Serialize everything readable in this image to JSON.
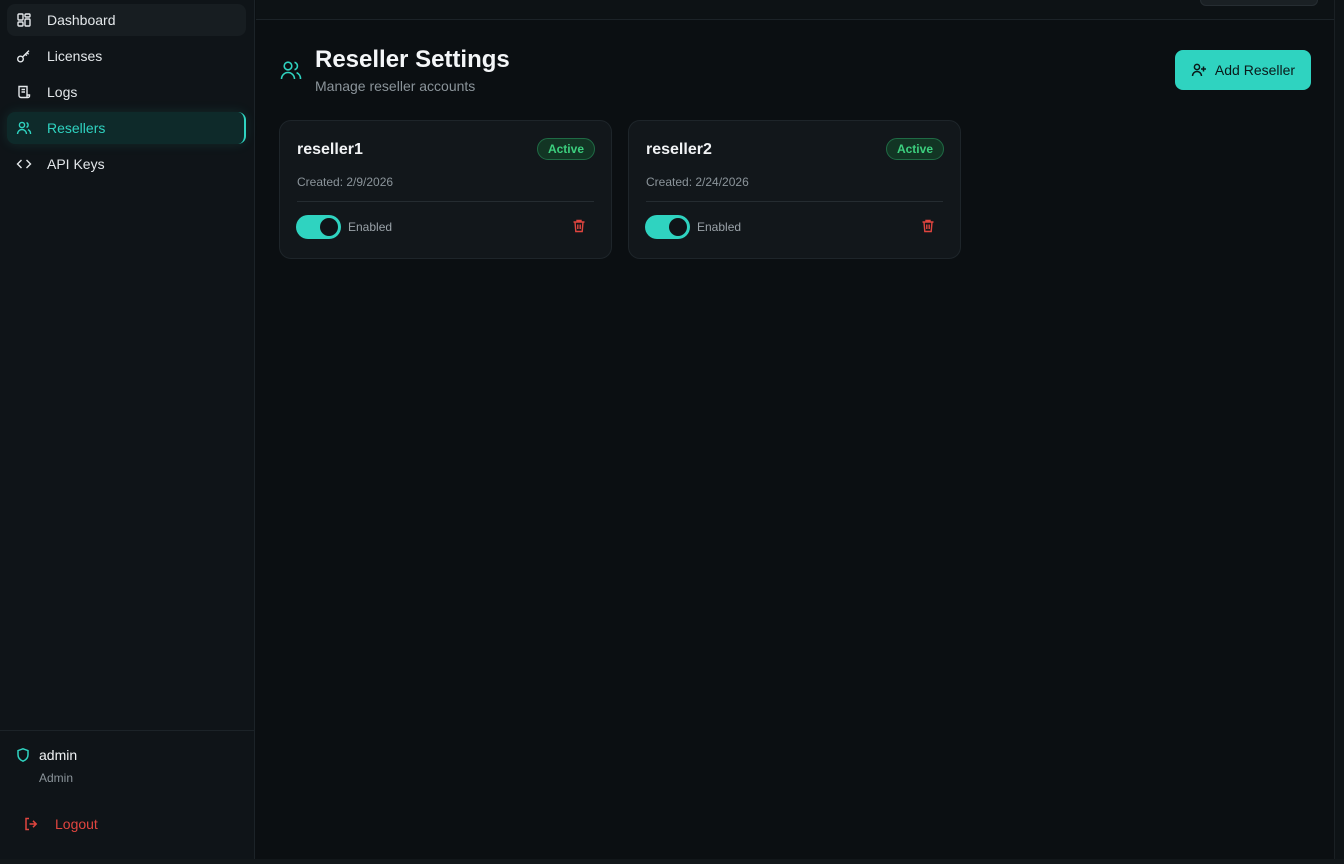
{
  "sidebar": {
    "items": [
      {
        "label": "Dashboard",
        "icon": "dashboard-grid-icon"
      },
      {
        "label": "Licenses",
        "icon": "key-icon"
      },
      {
        "label": "Logs",
        "icon": "scroll-icon"
      },
      {
        "label": "Resellers",
        "icon": "users-icon"
      },
      {
        "label": "API Keys",
        "icon": "code-icon"
      }
    ],
    "active": "Resellers",
    "user": {
      "name": "admin",
      "role": "Admin"
    },
    "logout_label": "Logout"
  },
  "header": {
    "title": "Reseller Settings",
    "subtitle": "Manage reseller accounts",
    "add_button_label": "Add Reseller"
  },
  "resellers": [
    {
      "name": "reseller1",
      "status": "Active",
      "created": "Created: 2/9/2026",
      "toggle_label": "Enabled"
    },
    {
      "name": "reseller2",
      "status": "Active",
      "created": "Created: 2/24/2026",
      "toggle_label": "Enabled"
    }
  ],
  "colors": {
    "accent": "#2fd3c0",
    "danger": "#e0453f",
    "success": "#3ccf7e",
    "background": "#0b0f12"
  }
}
